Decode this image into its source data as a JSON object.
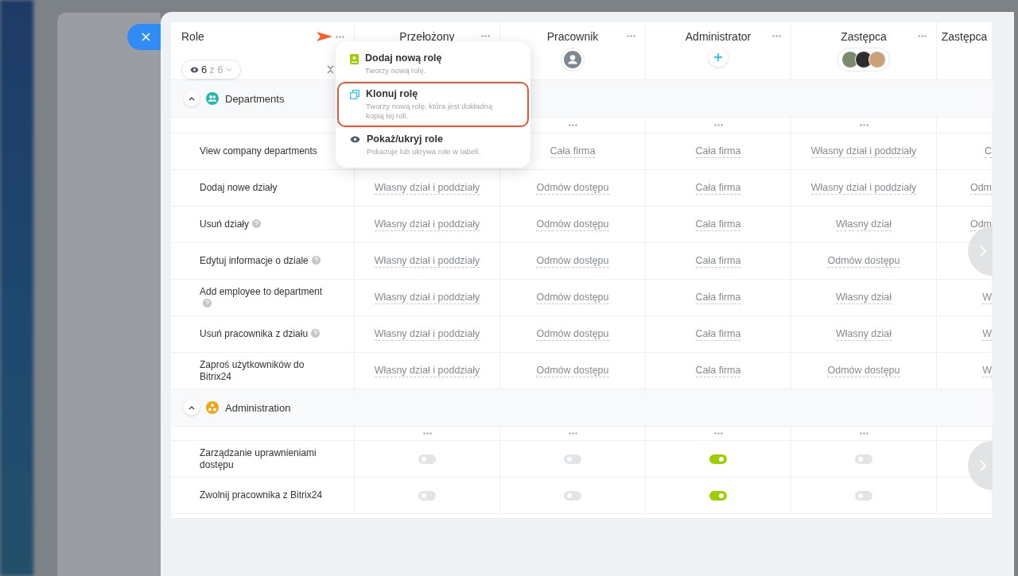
{
  "role_header": {
    "title": "Role",
    "visible_count": "6",
    "total": "z 6"
  },
  "columns": [
    {
      "name": "Przełożony",
      "kind": "plain"
    },
    {
      "name": "Pracownik",
      "kind": "user"
    },
    {
      "name": "Administrator",
      "kind": "add"
    },
    {
      "name": "Zastępca",
      "kind": "group"
    },
    {
      "name": "Zastępca",
      "kind": "plain"
    }
  ],
  "menu": {
    "items": [
      {
        "kind": "add",
        "title": "Dodaj nową rolę",
        "description": "Tworzy nową rolę.",
        "selected": false
      },
      {
        "kind": "copy",
        "title": "Klonuj rolę",
        "description": "Tworzy nową rolę, która jest dokładną kopią tej roli.",
        "selected": true
      },
      {
        "kind": "eye",
        "title": "Pokaż/ukryj role",
        "description": "Pokazuje lub ukrywa role w tabeli.",
        "selected": false
      }
    ]
  },
  "sections": [
    {
      "title": "Departments",
      "color": "#1fb9a9",
      "expanded": true,
      "rows": [
        {
          "label": "View company departments",
          "help": false,
          "kind": "select",
          "cells": [
            null,
            "Cała firma",
            "Cała firma",
            "Własny dział i poddziały",
            "C"
          ]
        },
        {
          "label": "Dodaj nowe działy",
          "help": false,
          "kind": "select",
          "cells": [
            "Własny dział i poddziały",
            "Odmów dostępu",
            "Cała firma",
            "Własny dział i poddziały",
            "Odm"
          ]
        },
        {
          "label": "Usuń działy",
          "help": true,
          "kind": "select",
          "cells": [
            "Własny dział i poddziały",
            "Odmów dostępu",
            "Cała firma",
            "Własny dział",
            "Odm"
          ]
        },
        {
          "label": "Edytuj informacje o dziale",
          "help": true,
          "kind": "select",
          "cells": [
            "Własny dział i poddziały",
            "Odmów dostępu",
            "Cała firma",
            "Odmów dostępu",
            null
          ]
        },
        {
          "label": "Add employee to department",
          "help": true,
          "kind": "select",
          "cells": [
            "Własny dział i poddziały",
            "Odmów dostępu",
            "Cała firma",
            "Własny dział",
            "W"
          ]
        },
        {
          "label": "Usuń pracownika z działu",
          "help": true,
          "kind": "select",
          "cells": [
            "Własny dział i poddziały",
            "Odmów dostępu",
            "Cała firma",
            "Własny dział",
            "W"
          ]
        },
        {
          "label": "Zaproś użytkowników do Bitrix24",
          "help": false,
          "kind": "select",
          "cells": [
            "Własny dział i poddziały",
            "Odmów dostępu",
            "Cała firma",
            "Odmów dostępu",
            "W"
          ]
        }
      ]
    },
    {
      "title": "Administration",
      "color": "#f5a30b",
      "expanded": true,
      "rows": [
        {
          "label": "Zarządzanie uprawnieniami dostępu",
          "help": false,
          "kind": "toggle",
          "cells": [
            {
              "on": false
            },
            {
              "on": false
            },
            {
              "on": true
            },
            {
              "on": false
            },
            null
          ]
        },
        {
          "label": "Zwolnij pracownika z Bitrix24",
          "help": false,
          "kind": "toggle",
          "cells": [
            {
              "on": false
            },
            {
              "on": false
            },
            {
              "on": true
            },
            {
              "on": false
            },
            null
          ]
        }
      ]
    }
  ]
}
